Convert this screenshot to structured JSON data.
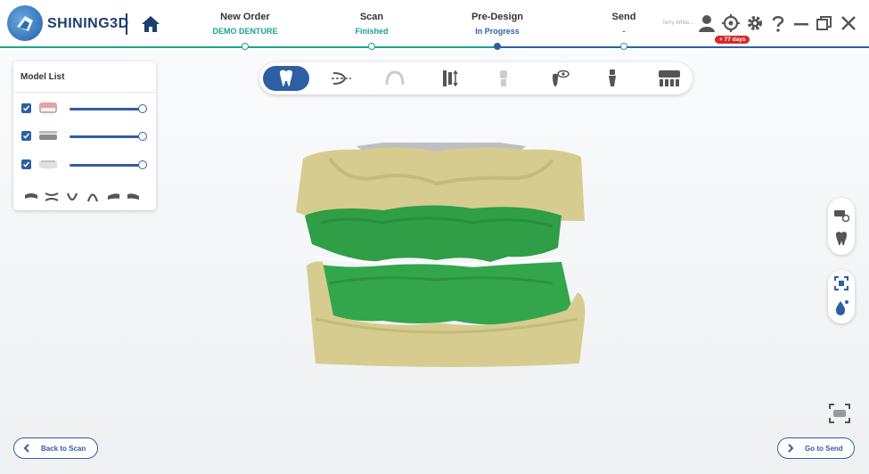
{
  "app": {
    "brand": "SHINING3D",
    "accent": "#2f5fa3",
    "brand_color": "#1d3f6e"
  },
  "header": {
    "steps": [
      {
        "title": "New Order",
        "status": "DEMO DENTURE",
        "status_color": "#1aa68a"
      },
      {
        "title": "Scan",
        "status": "Finished",
        "status_color": "#1aa68a"
      },
      {
        "title": "Pre-Design",
        "status": "In Progress",
        "status_color": "#2f5fa3"
      },
      {
        "title": "Send",
        "status": "-",
        "status_color": "#555555"
      }
    ],
    "user_name": "Terry White...",
    "license_badge": "+ 77 days",
    "icons": [
      "home-icon",
      "user-icon",
      "target-icon",
      "gear-icon",
      "help-icon",
      "minimize-icon",
      "restore-icon",
      "close-icon"
    ]
  },
  "model_list": {
    "title": "Model List",
    "items": [
      {
        "name": "upper-denture",
        "checked": true,
        "opacity": 1.0
      },
      {
        "name": "lower-denture",
        "checked": true,
        "opacity": 1.0
      },
      {
        "name": "base-model",
        "checked": true,
        "opacity": 1.0
      }
    ],
    "view_icons": [
      "view-front-icon",
      "view-back-icon",
      "view-lower-icon",
      "view-upper-icon",
      "view-left-icon",
      "view-right-icon"
    ]
  },
  "toolbar": {
    "tools": [
      {
        "name": "teeth-tool",
        "state": "active"
      },
      {
        "name": "occlusal-plane-tool",
        "state": "enabled"
      },
      {
        "name": "arch-tool",
        "state": "disabled"
      },
      {
        "name": "tooth-align-tool",
        "state": "enabled"
      },
      {
        "name": "tooth-single-tool",
        "state": "disabled"
      },
      {
        "name": "tooth-view-tool",
        "state": "enabled"
      },
      {
        "name": "implant-tool",
        "state": "enabled"
      },
      {
        "name": "library-tool",
        "state": "enabled"
      }
    ]
  },
  "side_tools": [
    "scan-settings-icon",
    "tooth-icon",
    "fit-view-icon",
    "droplet-icon"
  ],
  "footer": {
    "back_label": "Back to Scan",
    "next_label": "Go to Send"
  }
}
